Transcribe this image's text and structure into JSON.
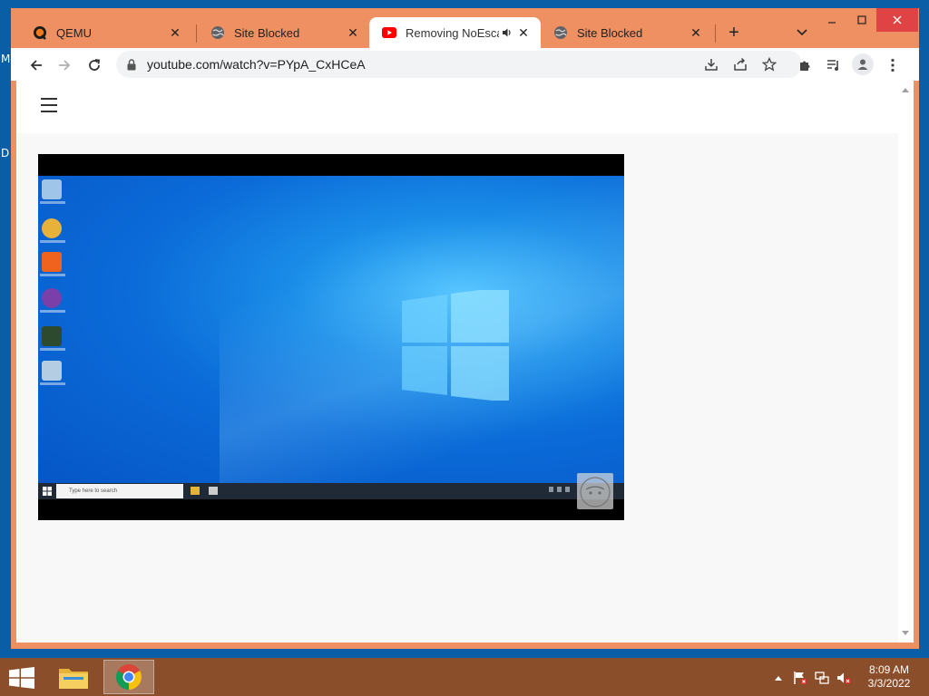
{
  "desktop": {
    "edge_letters": [
      "M",
      "D"
    ]
  },
  "browser": {
    "tabs": [
      {
        "title": "QEMU",
        "icon": "qemu-icon",
        "active": false
      },
      {
        "title": "Site Blocked",
        "icon": "globe-icon",
        "active": false
      },
      {
        "title": "Removing NoEscape",
        "icon": "youtube-icon",
        "active": true,
        "audio": true
      },
      {
        "title": "Site Blocked",
        "icon": "globe-icon",
        "active": false
      }
    ],
    "url": "youtube.com/watch?v=PYpA_CxHCeA"
  },
  "video": {
    "search_placeholder": "Type here to search"
  },
  "taskbar": {
    "time": "8:09 AM",
    "date": "3/3/2022"
  },
  "colors": {
    "window_frame": "#ef9062",
    "taskbar": "#8a4e2b",
    "youtube_red": "#ff0000",
    "close_red": "#e04343"
  }
}
